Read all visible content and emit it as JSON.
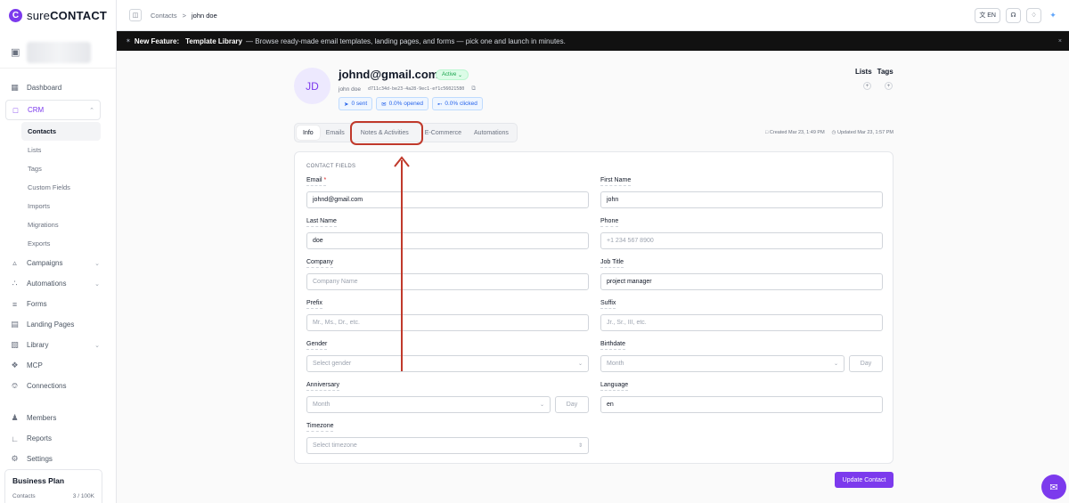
{
  "brand": {
    "name_light": "sure",
    "name_bold": "CONTACT"
  },
  "nav": {
    "dashboard": "Dashboard",
    "crm": "CRM",
    "crm_sub": [
      "Contacts",
      "Lists",
      "Tags",
      "Custom Fields",
      "Imports",
      "Migrations",
      "Exports"
    ],
    "campaigns": "Campaigns",
    "automations": "Automations",
    "forms": "Forms",
    "landing_pages": "Landing Pages",
    "library": "Library",
    "mcp": "MCP",
    "connections": "Connections",
    "members": "Members",
    "reports": "Reports",
    "settings": "Settings"
  },
  "plan": {
    "title": "Business Plan",
    "contacts_label": "Contacts",
    "contacts_value": "3 / 100K"
  },
  "topbar": {
    "crumb_root": "Contacts",
    "crumb_sep": ">",
    "crumb_current": "john doe",
    "lang": "EN"
  },
  "announce": {
    "prefix": "New Feature:",
    "title": "Template Library",
    "text": "— Browse ready-made email templates, landing pages, and forms — pick one and launch in minutes.",
    "close": "×"
  },
  "contact": {
    "initials": "JD",
    "email": "johnd@gmail.com",
    "status": "Active",
    "name": "john doe",
    "uuid": "d711c34d-be23-4a28-9ec1-ef1c56021580",
    "sent": "0 sent",
    "opened": "0.0% opened",
    "clicked": "0.0% clicked"
  },
  "lists_tags": {
    "lists": "Lists",
    "tags": "Tags"
  },
  "tabs": [
    "Info",
    "Emails",
    "Notes & Activities",
    "E-Commerce",
    "Automations"
  ],
  "meta": {
    "created": "Created Mar 23, 1:49 PM",
    "updated": "Updated Mar 23, 1:57 PM"
  },
  "form": {
    "section_title": "CONTACT FIELDS",
    "email": {
      "label": "Email",
      "req": "*",
      "value": "johnd@gmail.com"
    },
    "first_name": {
      "label": "First Name",
      "value": "john"
    },
    "last_name": {
      "label": "Last Name",
      "value": "doe"
    },
    "phone": {
      "label": "Phone",
      "placeholder": "+1 234 567 8900"
    },
    "company": {
      "label": "Company",
      "placeholder": "Company Name"
    },
    "job_title": {
      "label": "Job Title",
      "value": "project manager"
    },
    "prefix": {
      "label": "Prefix",
      "placeholder": "Mr., Ms., Dr., etc."
    },
    "suffix": {
      "label": "Suffix",
      "placeholder": "Jr., Sr., III, etc."
    },
    "gender": {
      "label": "Gender",
      "placeholder": "Select gender"
    },
    "birthdate": {
      "label": "Birthdate",
      "month": "Month",
      "day": "Day"
    },
    "anniversary": {
      "label": "Anniversary",
      "month": "Month",
      "day": "Day"
    },
    "language": {
      "label": "Language",
      "value": "en"
    },
    "timezone": {
      "label": "Timezone",
      "placeholder": "Select timezone"
    }
  },
  "update_button": "Update Contact",
  "colors": {
    "accent": "#7c3aed",
    "highlight": "#c0392b",
    "active_green": "#16a34a",
    "stat_blue": "#2563eb"
  }
}
